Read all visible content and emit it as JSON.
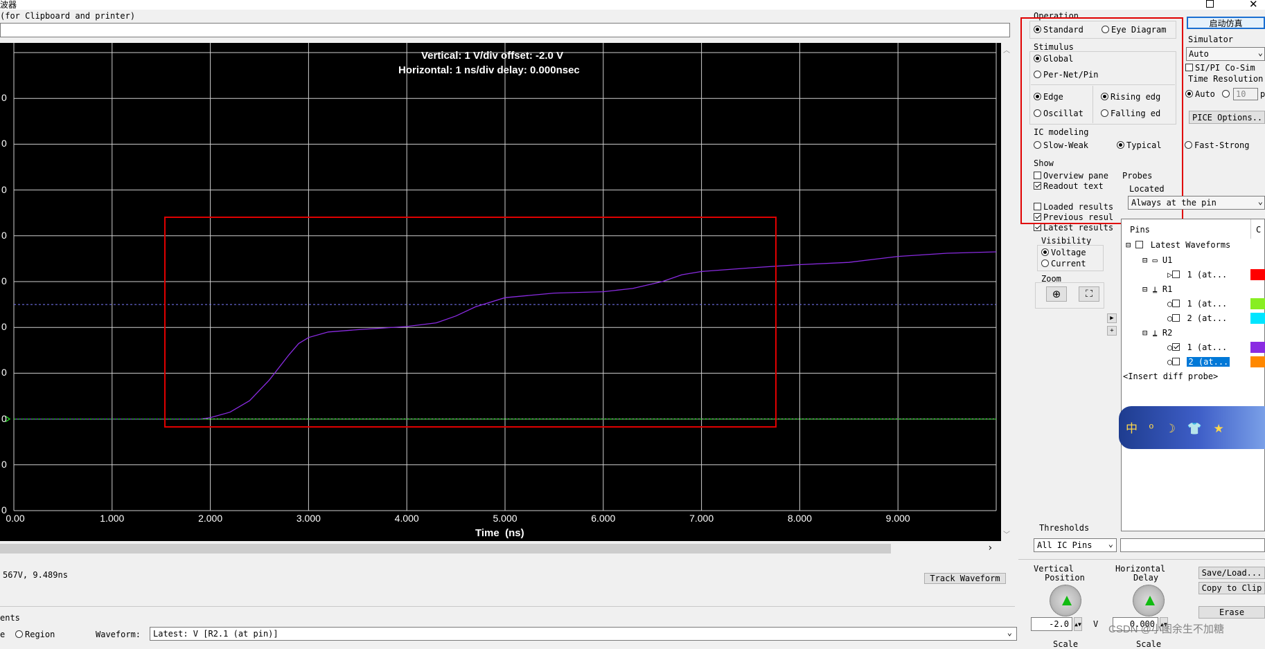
{
  "window": {
    "title_fragment": "波器",
    "min_icon": "minimize-icon",
    "restore_icon": "restore-icon",
    "close_icon": "close-icon"
  },
  "top_field": {
    "label": "(for Clipboard and printer)",
    "value": ""
  },
  "scope": {
    "readout_vertical": "Vertical: 1  V/div  offset: -2.0 V",
    "readout_horizontal": "Horizontal: 1 ns/div  delay: 0.000nsec",
    "x_axis_label": "Time  (ns)",
    "x_ticks": [
      "0.00",
      "1.000",
      "2.000",
      "3.000",
      "4.000",
      "5.000",
      "6.000",
      "7.000",
      "8.000",
      "9.000"
    ],
    "y_tick_fragments": [
      "0",
      "0",
      "0",
      "0",
      "0",
      "0",
      "0",
      "0",
      "0",
      "0"
    ],
    "background": "#000000",
    "grid_color": "#d0d0d0",
    "waveform_color": "#8a2be2",
    "reference_color": "#22cc22",
    "threshold_line_color": "#7b7bff"
  },
  "chart_data": {
    "type": "line",
    "xlabel": "Time  (ns)",
    "xlim": [
      0,
      10
    ],
    "ylim": [
      -2,
      8
    ],
    "series": [
      {
        "color": "#8a2be2",
        "x": [
          0,
          1.9,
          2.0,
          2.2,
          2.4,
          2.6,
          2.8,
          2.9,
          3.0,
          3.2,
          3.5,
          4.0,
          4.3,
          4.5,
          4.7,
          5.0,
          5.5,
          6.0,
          6.3,
          6.6,
          6.8,
          7.0,
          7.5,
          8.0,
          8.5,
          9.0,
          9.5,
          10.0
        ],
        "y": [
          0,
          0,
          0.03,
          0.15,
          0.4,
          0.85,
          1.4,
          1.65,
          1.78,
          1.9,
          1.95,
          2.02,
          2.1,
          2.25,
          2.45,
          2.65,
          2.75,
          2.78,
          2.85,
          3.0,
          3.15,
          3.22,
          3.3,
          3.37,
          3.42,
          3.55,
          3.62,
          3.65
        ]
      },
      {
        "color": "#22cc22",
        "x": [
          0,
          10
        ],
        "y": [
          0,
          0
        ]
      }
    ],
    "reference_lines": [
      {
        "y": 2.5,
        "color": "#7b7bff"
      }
    ]
  },
  "below_scope": {
    "readout": "567V, 9.489ns",
    "track_button": "Track Waveform",
    "measurements_label": "ents",
    "region_radio_prefix": "e",
    "region_radio": "Region",
    "waveform_label": "Waveform:",
    "waveform_value": "Latest: V [R2.1 (at pin)]"
  },
  "operation": {
    "title": "Operation",
    "standard": "Standard",
    "eye": "Eye Diagram",
    "stimulus_title": "Stimulus",
    "global": "Global",
    "per_net": "Per-Net/Pin",
    "edge": "Edge",
    "oscillator": "Oscillat",
    "rising": "Rising edg",
    "falling": "Falling ed",
    "ic_title": "IC modeling",
    "slow": "Slow-Weak",
    "typical": "Typical",
    "fast": "Fast-Strong",
    "show_title": "Show",
    "overview": "Overview pane",
    "readout_text": "Readout text",
    "loaded": "Loaded results",
    "previous": "Previous resul",
    "latest": "Latest results",
    "visibility_title": "Visibility",
    "voltage": "Voltage",
    "current": "Current",
    "zoom_title": "Zoom",
    "thresholds_title": "Thresholds",
    "thresholds_value": "All IC Pins"
  },
  "right_col": {
    "start_button": "启动仿真",
    "simulator_title": "Simulator",
    "simulator_value": "Auto",
    "sipi": "SI/PI Co-Sim",
    "time_res": "Time Resolution",
    "auto": "Auto",
    "res_value": "10",
    "res_unit": "p",
    "spice": "PICE Options...",
    "probes_title": "Probes",
    "located": "Located",
    "located_value": "Always at the pin"
  },
  "tree": {
    "header_pins": "Pins",
    "header_c": "C",
    "root": "Latest Waveforms",
    "u1": "U1",
    "u1_pin1": "1 (at...",
    "r1": "R1",
    "r1_pin1": "1 (at...",
    "r1_pin2": "2 (at...",
    "r2": "R2",
    "r2_pin1": "1 (at...",
    "r2_pin2": "2 (at...",
    "insert": "<Insert diff probe>",
    "colors": [
      "#ff0000",
      "#88ee22",
      "#00e5ff",
      "#8a2be2",
      "#ff8800"
    ]
  },
  "bottom_controls": {
    "vertical": "Vertical",
    "position": "Position",
    "horizontal": "Horizontal",
    "delay": "Delay",
    "vpos_value": "-2.0",
    "vpos_unit": "V",
    "hdelay_value": "0.000",
    "scale1": "Scale",
    "scale2": "Scale",
    "save_load": "Save/Load...",
    "copy": "Copy to Clip",
    "erase": "Erase"
  },
  "banner": {
    "text": "中 º ☽ 👕 ★"
  },
  "watermark": "CSDN @小图余生不加糖"
}
